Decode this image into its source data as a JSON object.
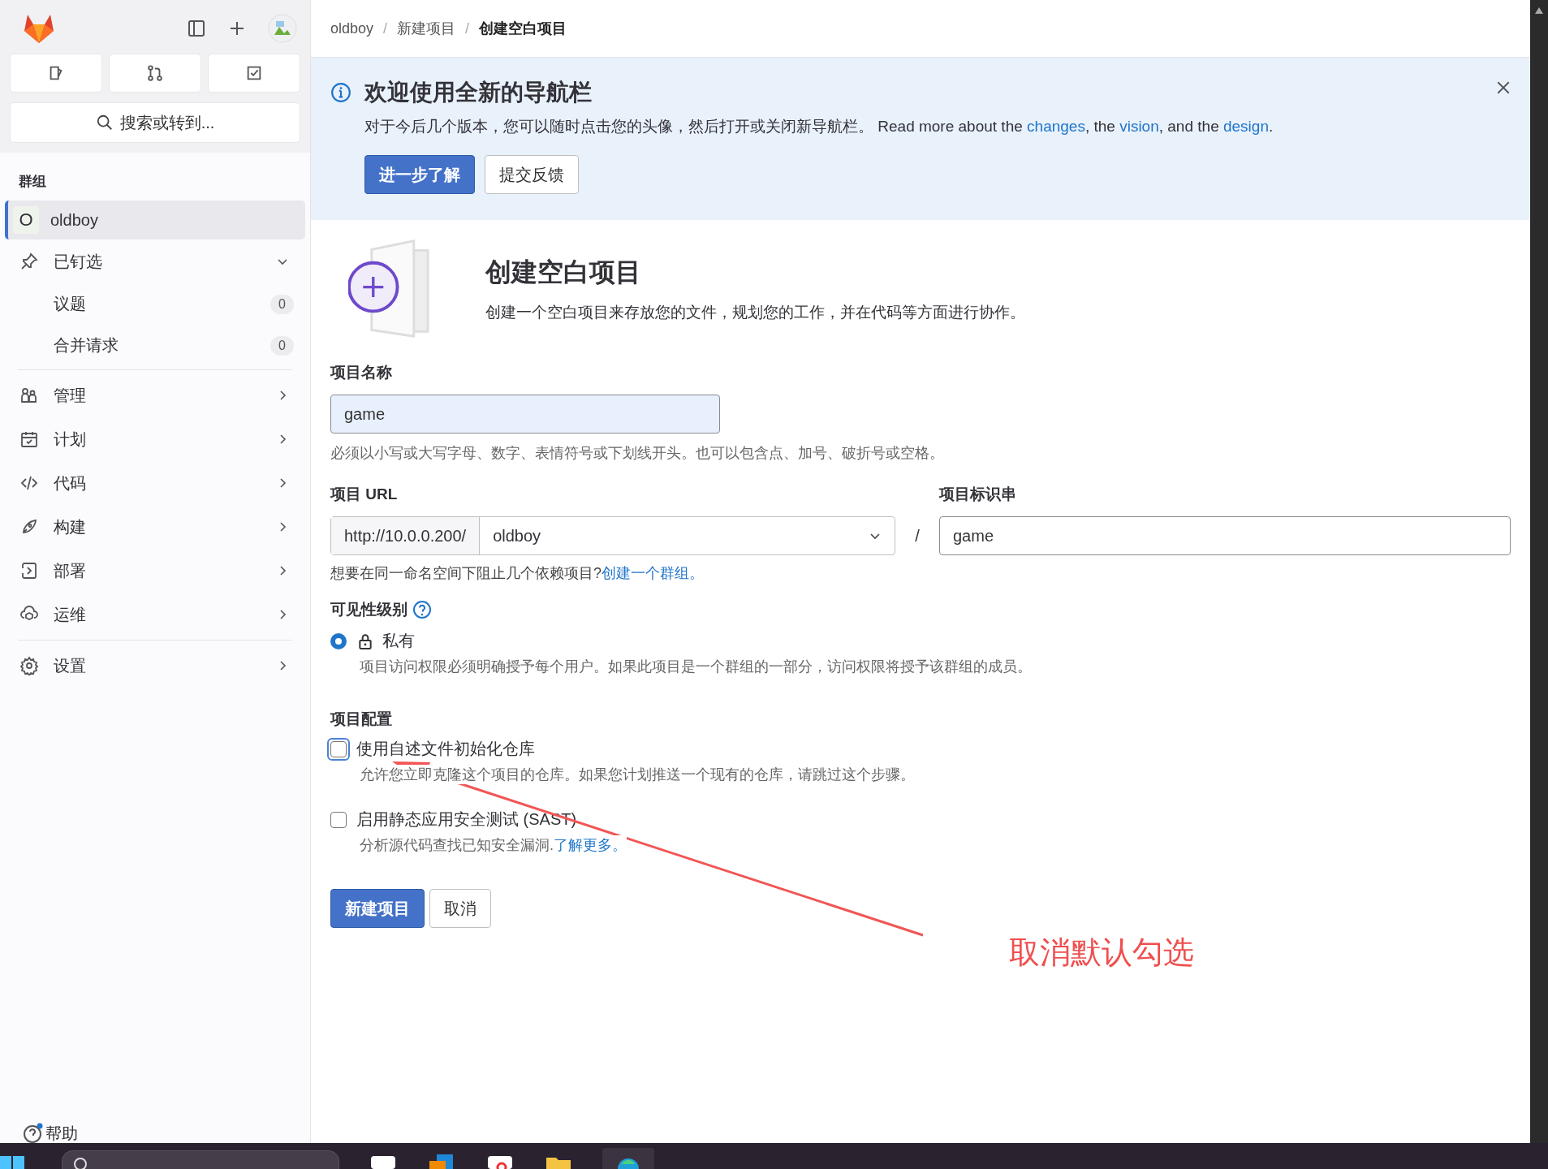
{
  "sidebar": {
    "search": {
      "placeholder": "搜索或转到..."
    },
    "section_title": "群组",
    "context": {
      "initial": "O",
      "name": "oldboy",
      "selected": true
    },
    "pinned": {
      "label": "已钉选",
      "expanded": true,
      "items": [
        {
          "label": "议题",
          "count": "0"
        },
        {
          "label": "合并请求",
          "count": "0"
        }
      ]
    },
    "menu": [
      {
        "label": "管理"
      },
      {
        "label": "计划"
      },
      {
        "label": "代码"
      },
      {
        "label": "构建"
      },
      {
        "label": "部署"
      },
      {
        "label": "运维"
      },
      {
        "label": "设置"
      }
    ],
    "help": "帮助"
  },
  "breadcrumb": [
    {
      "text": "oldboy"
    },
    {
      "separator": "/",
      "text": "新建项目"
    },
    {
      "separator": "/",
      "text": "创建空白项目"
    }
  ],
  "banner": {
    "title": "欢迎使用全新的导航栏",
    "parts": [
      {
        "kind": "text",
        "text": "对于今后几个版本，您可以随时点击您的头像，然后打开或关闭新导航栏。 Read more about the "
      },
      {
        "kind": "link",
        "text": "changes"
      },
      {
        "kind": "text",
        "text": ", the "
      },
      {
        "kind": "link",
        "text": "vision"
      },
      {
        "kind": "text",
        "text": ", and the "
      },
      {
        "kind": "link",
        "text": "design"
      },
      {
        "kind": "text",
        "text": "."
      }
    ],
    "buttons": [
      {
        "label": "进一步了解",
        "kind": "primary"
      },
      {
        "label": "提交反馈",
        "kind": "secondary"
      }
    ]
  },
  "header": {
    "title": "创建空白项目",
    "description": "创建一个空白项目来存放您的文件，规划您的工作，并在代码等方面进行协作。"
  },
  "form": {
    "name": {
      "label": "项目名称",
      "value": "game",
      "help": "必须以小写或大写字母、数字、表情符号或下划线开头。也可以包含点、加号、破折号或空格。"
    },
    "url": {
      "label": "项目 URL",
      "prefix": "http://10.0.0.200/",
      "namespace": "oldboy",
      "separator": "/",
      "hint": "想要在同一命名空间下阻止几个依赖项目?",
      "hint_link": "创建一个群组。"
    },
    "slug": {
      "label": "项目标识串",
      "value": "game"
    },
    "visibility": {
      "label": "可见性级别",
      "options": [
        {
          "label": "私有",
          "description": "项目访问权限必须明确授予每个用户。如果此项目是一个群组的一部分，访问权限将授予该群组的成员。",
          "selected": true
        }
      ]
    },
    "config": {
      "label": "项目配置",
      "options": [
        {
          "label": "使用自述文件初始化仓库",
          "description": "允许您立即克隆这个项目的仓库。如果您计划推送一个现有的仓库，请跳过这个步骤。",
          "checked": false,
          "focused": true
        },
        {
          "label": "启用静态应用安全测试 (SAST)",
          "description": "分析源代码查找已知安全漏洞.",
          "link": "了解更多。",
          "checked": false,
          "focused": false
        }
      ]
    },
    "buttons": [
      {
        "label": "新建项目",
        "kind": "primary"
      },
      {
        "label": "取消",
        "kind": "secondary"
      }
    ]
  },
  "annotation": {
    "text": "取消默认勾选"
  }
}
